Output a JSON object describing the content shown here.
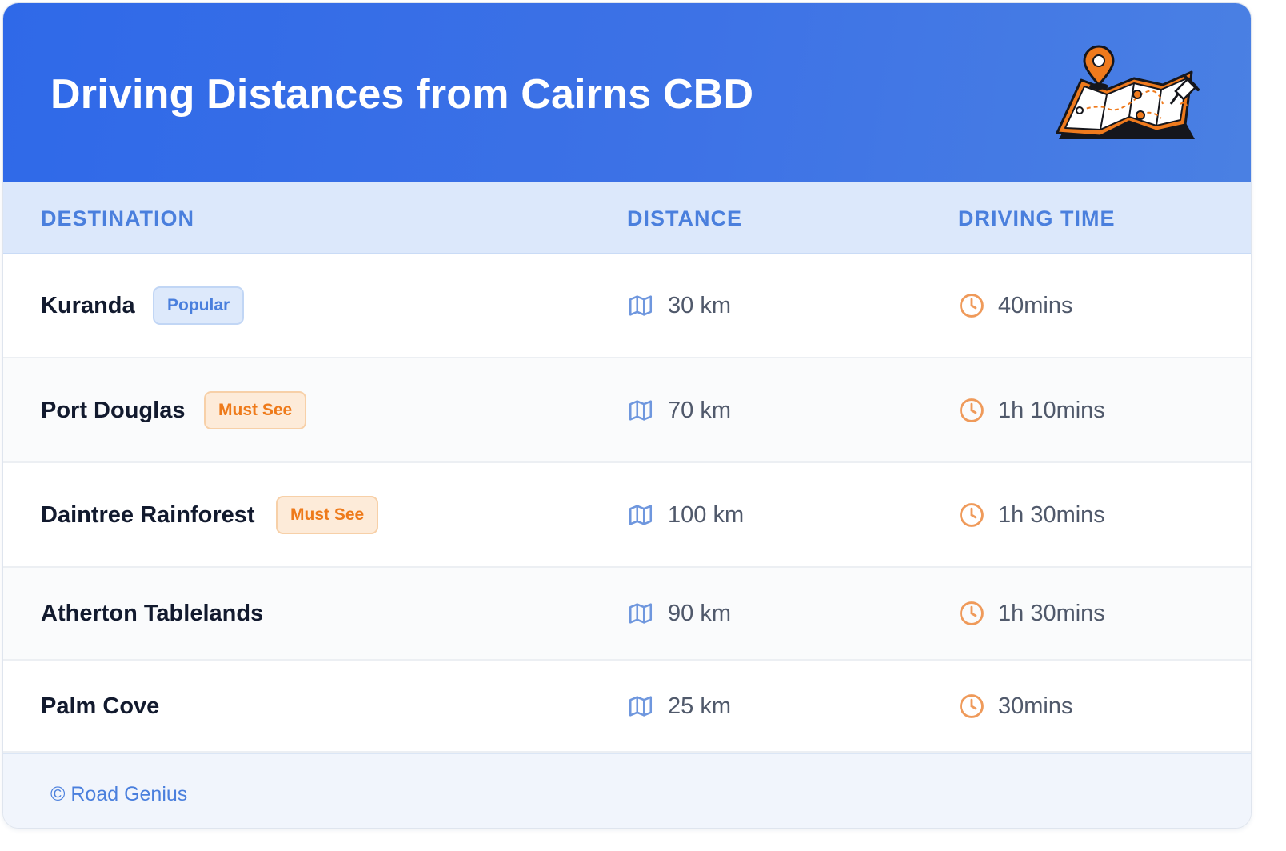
{
  "header": {
    "title": "Driving Distances from Cairns CBD"
  },
  "table": {
    "columns": [
      "DESTINATION",
      "DISTANCE",
      "DRIVING TIME"
    ],
    "rows": [
      {
        "destination": "Kuranda",
        "badge": "Popular",
        "distance": "30 km",
        "time": "40mins"
      },
      {
        "destination": "Port Douglas",
        "badge": "Must See",
        "distance": "70 km",
        "time": "1h 10mins"
      },
      {
        "destination": "Daintree Rainforest",
        "badge": "Must See",
        "distance": "100 km",
        "time": "1h 30mins"
      },
      {
        "destination": "Atherton Tablelands",
        "badge": "",
        "distance": "90 km",
        "time": "1h 30mins"
      },
      {
        "destination": "Palm Cove",
        "badge": "",
        "distance": "25 km",
        "time": "30mins"
      }
    ]
  },
  "footer": {
    "text": "© Road Genius"
  },
  "colors": {
    "header_blue": "#2f69e8",
    "accent_blue": "#4a7fdd",
    "accent_orange": "#ee7a1a"
  },
  "icons": {
    "header": "map-pin-illustration",
    "distance": "map-icon",
    "time": "clock-icon"
  }
}
